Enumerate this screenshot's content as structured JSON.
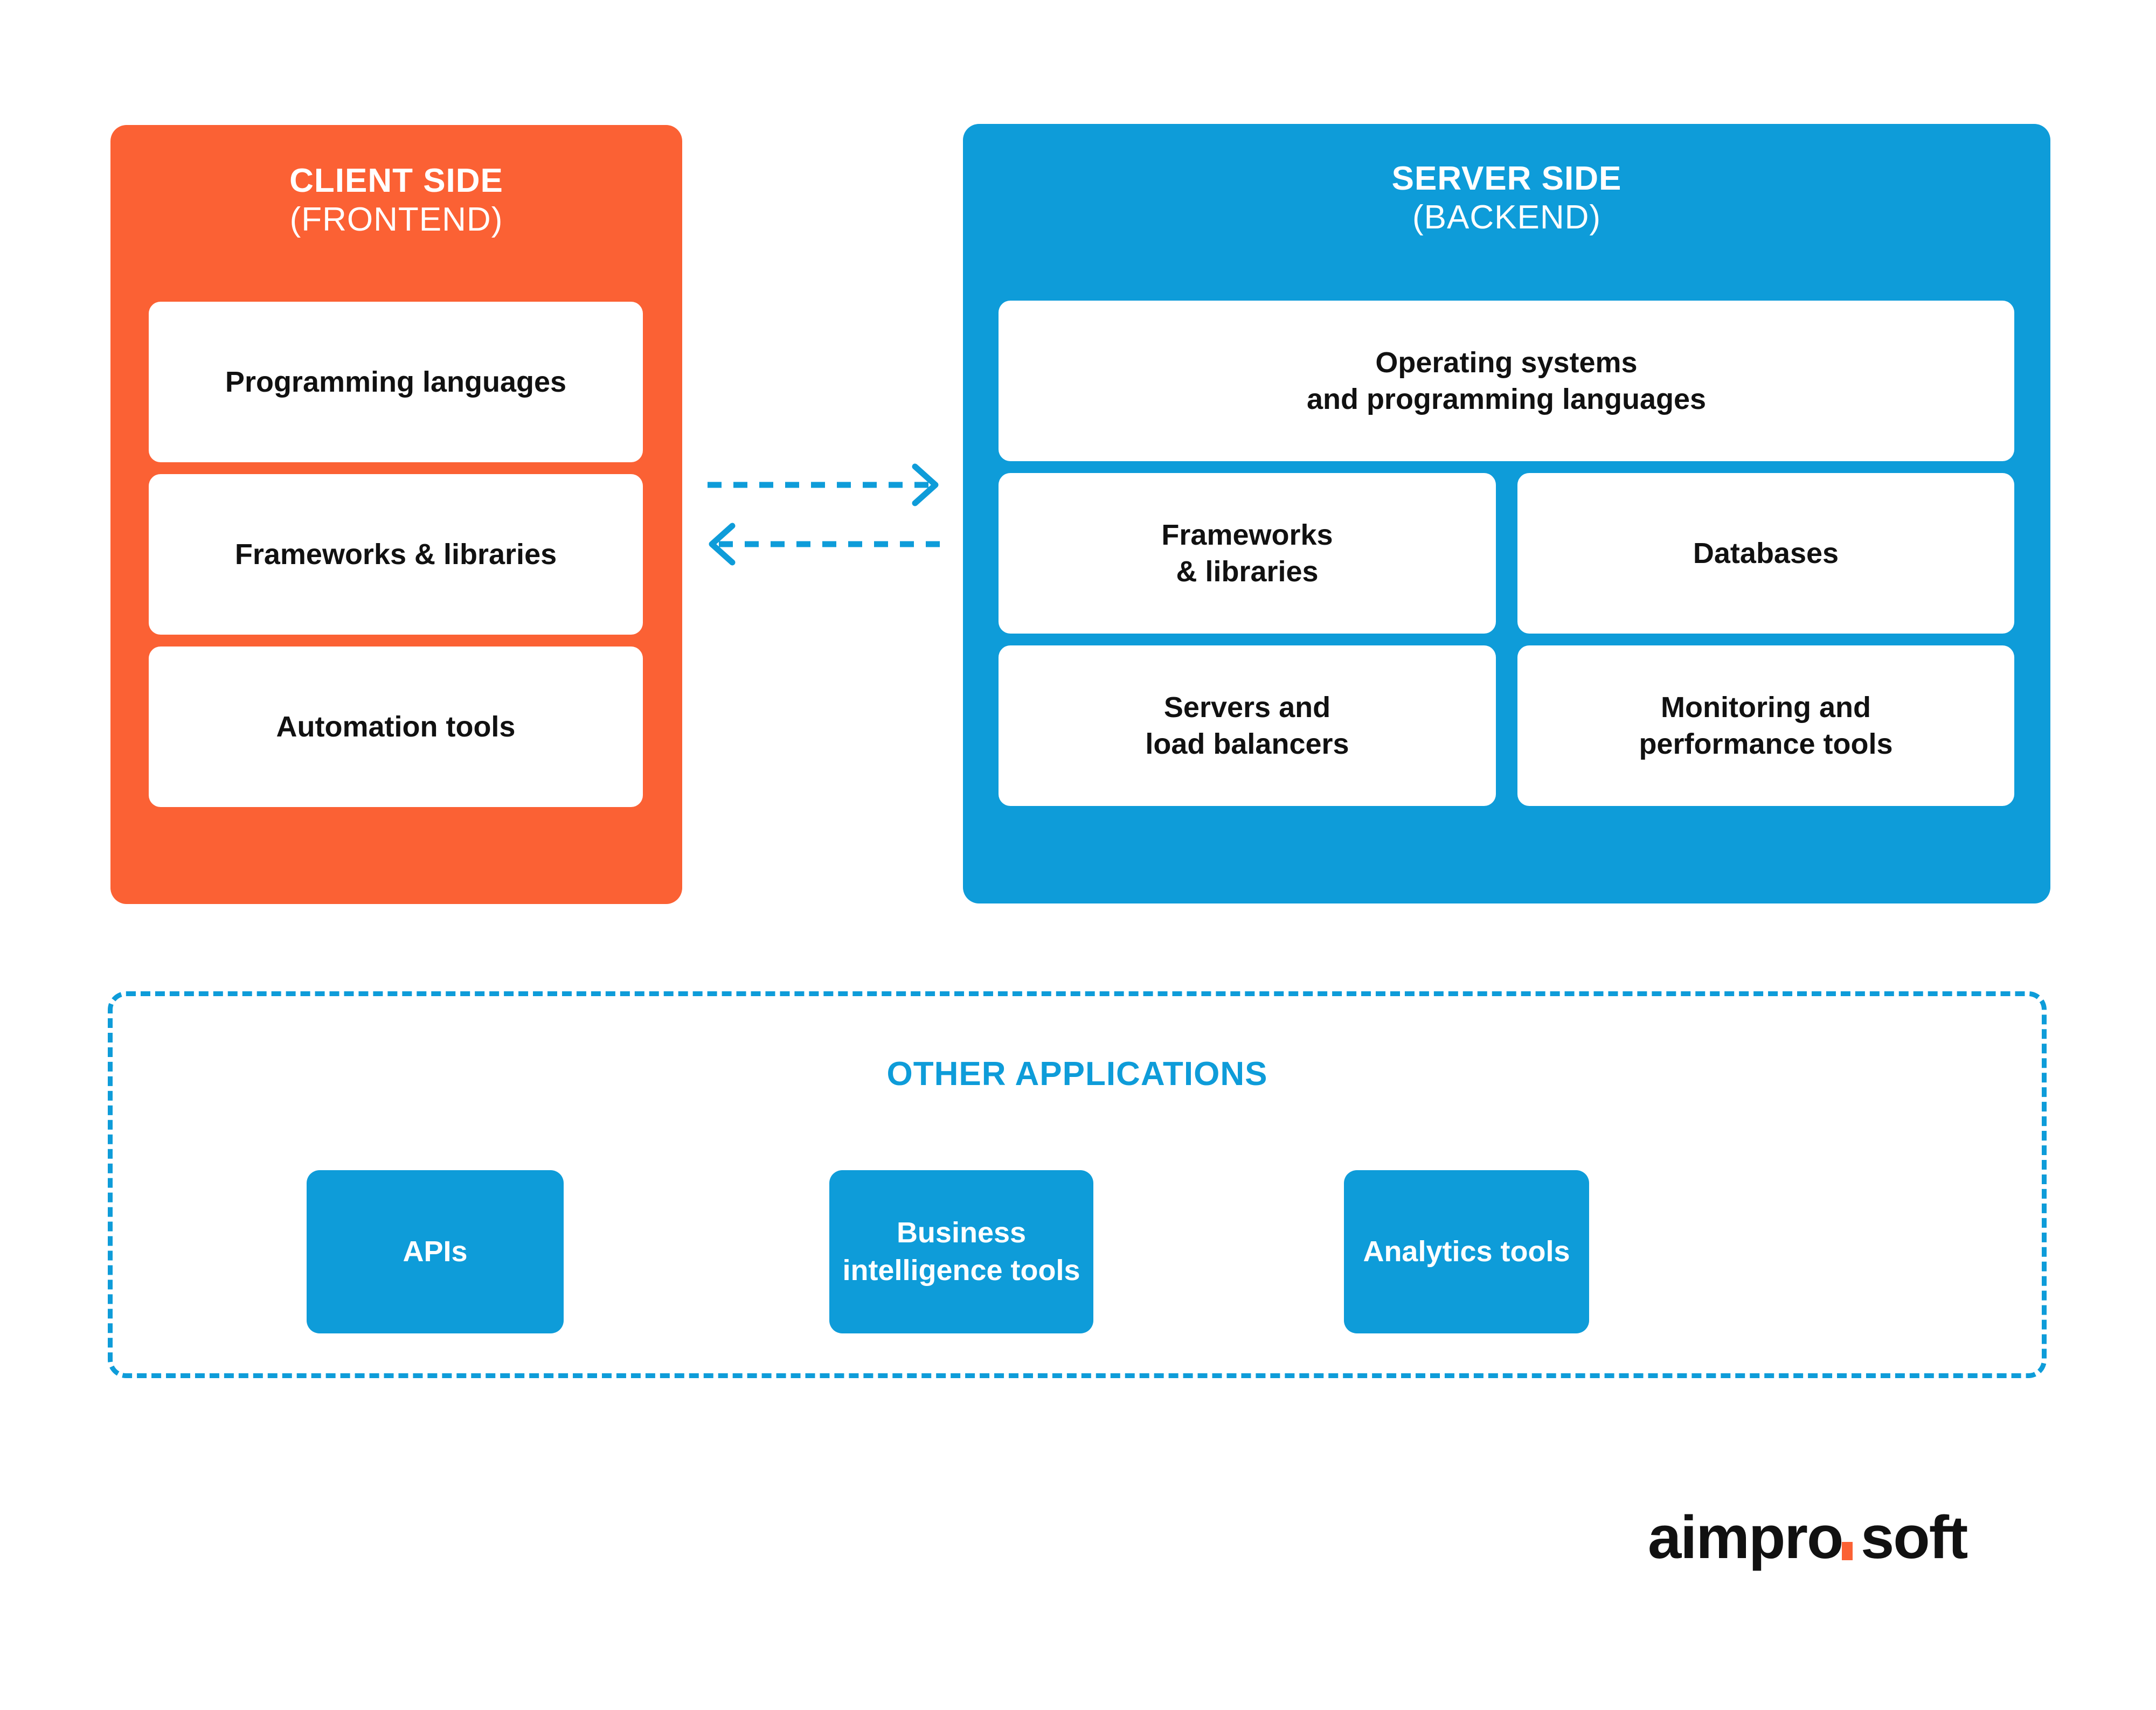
{
  "diagram": {
    "colors": {
      "client_panel": "#FB6134",
      "server_panel": "#0E9CD9",
      "accent_blue": "#0E9CD9",
      "accent_orange": "#FB6134",
      "card_background": "#FFFFFF",
      "card_text": "#111111",
      "background": "#FFFFFF"
    },
    "client_side": {
      "title": "CLIENT SIDE",
      "subtitle": "(FRONTEND)",
      "cards": [
        {
          "label": "Programming languages"
        },
        {
          "label": "Frameworks & libraries"
        },
        {
          "label": "Automation tools"
        }
      ]
    },
    "server_side": {
      "title": "SERVER SIDE",
      "subtitle": "(BACKEND)",
      "top_card": {
        "line1": "Operating systems",
        "line2": "and programming languages"
      },
      "cards": [
        {
          "line1": "Frameworks",
          "line2": "& libraries"
        },
        {
          "line1": "Databases",
          "line2": ""
        },
        {
          "line1": "Servers and",
          "line2": "load balancers"
        },
        {
          "line1": "Monitoring and",
          "line2": "performance tools"
        }
      ]
    },
    "connectors": {
      "forward_arrow": "dashed-arrow-right",
      "backward_arrow": "dashed-arrow-left"
    },
    "other_applications": {
      "title": "OTHER APPLICATIONS",
      "cards": [
        {
          "line1": "APIs",
          "line2": ""
        },
        {
          "line1": "Business",
          "line2": "intelligence tools"
        },
        {
          "line1": "Analytics tools",
          "line2": ""
        }
      ]
    },
    "logo": {
      "name_part1": "aimpro",
      "dot": ".",
      "name_part2": "soft"
    }
  }
}
